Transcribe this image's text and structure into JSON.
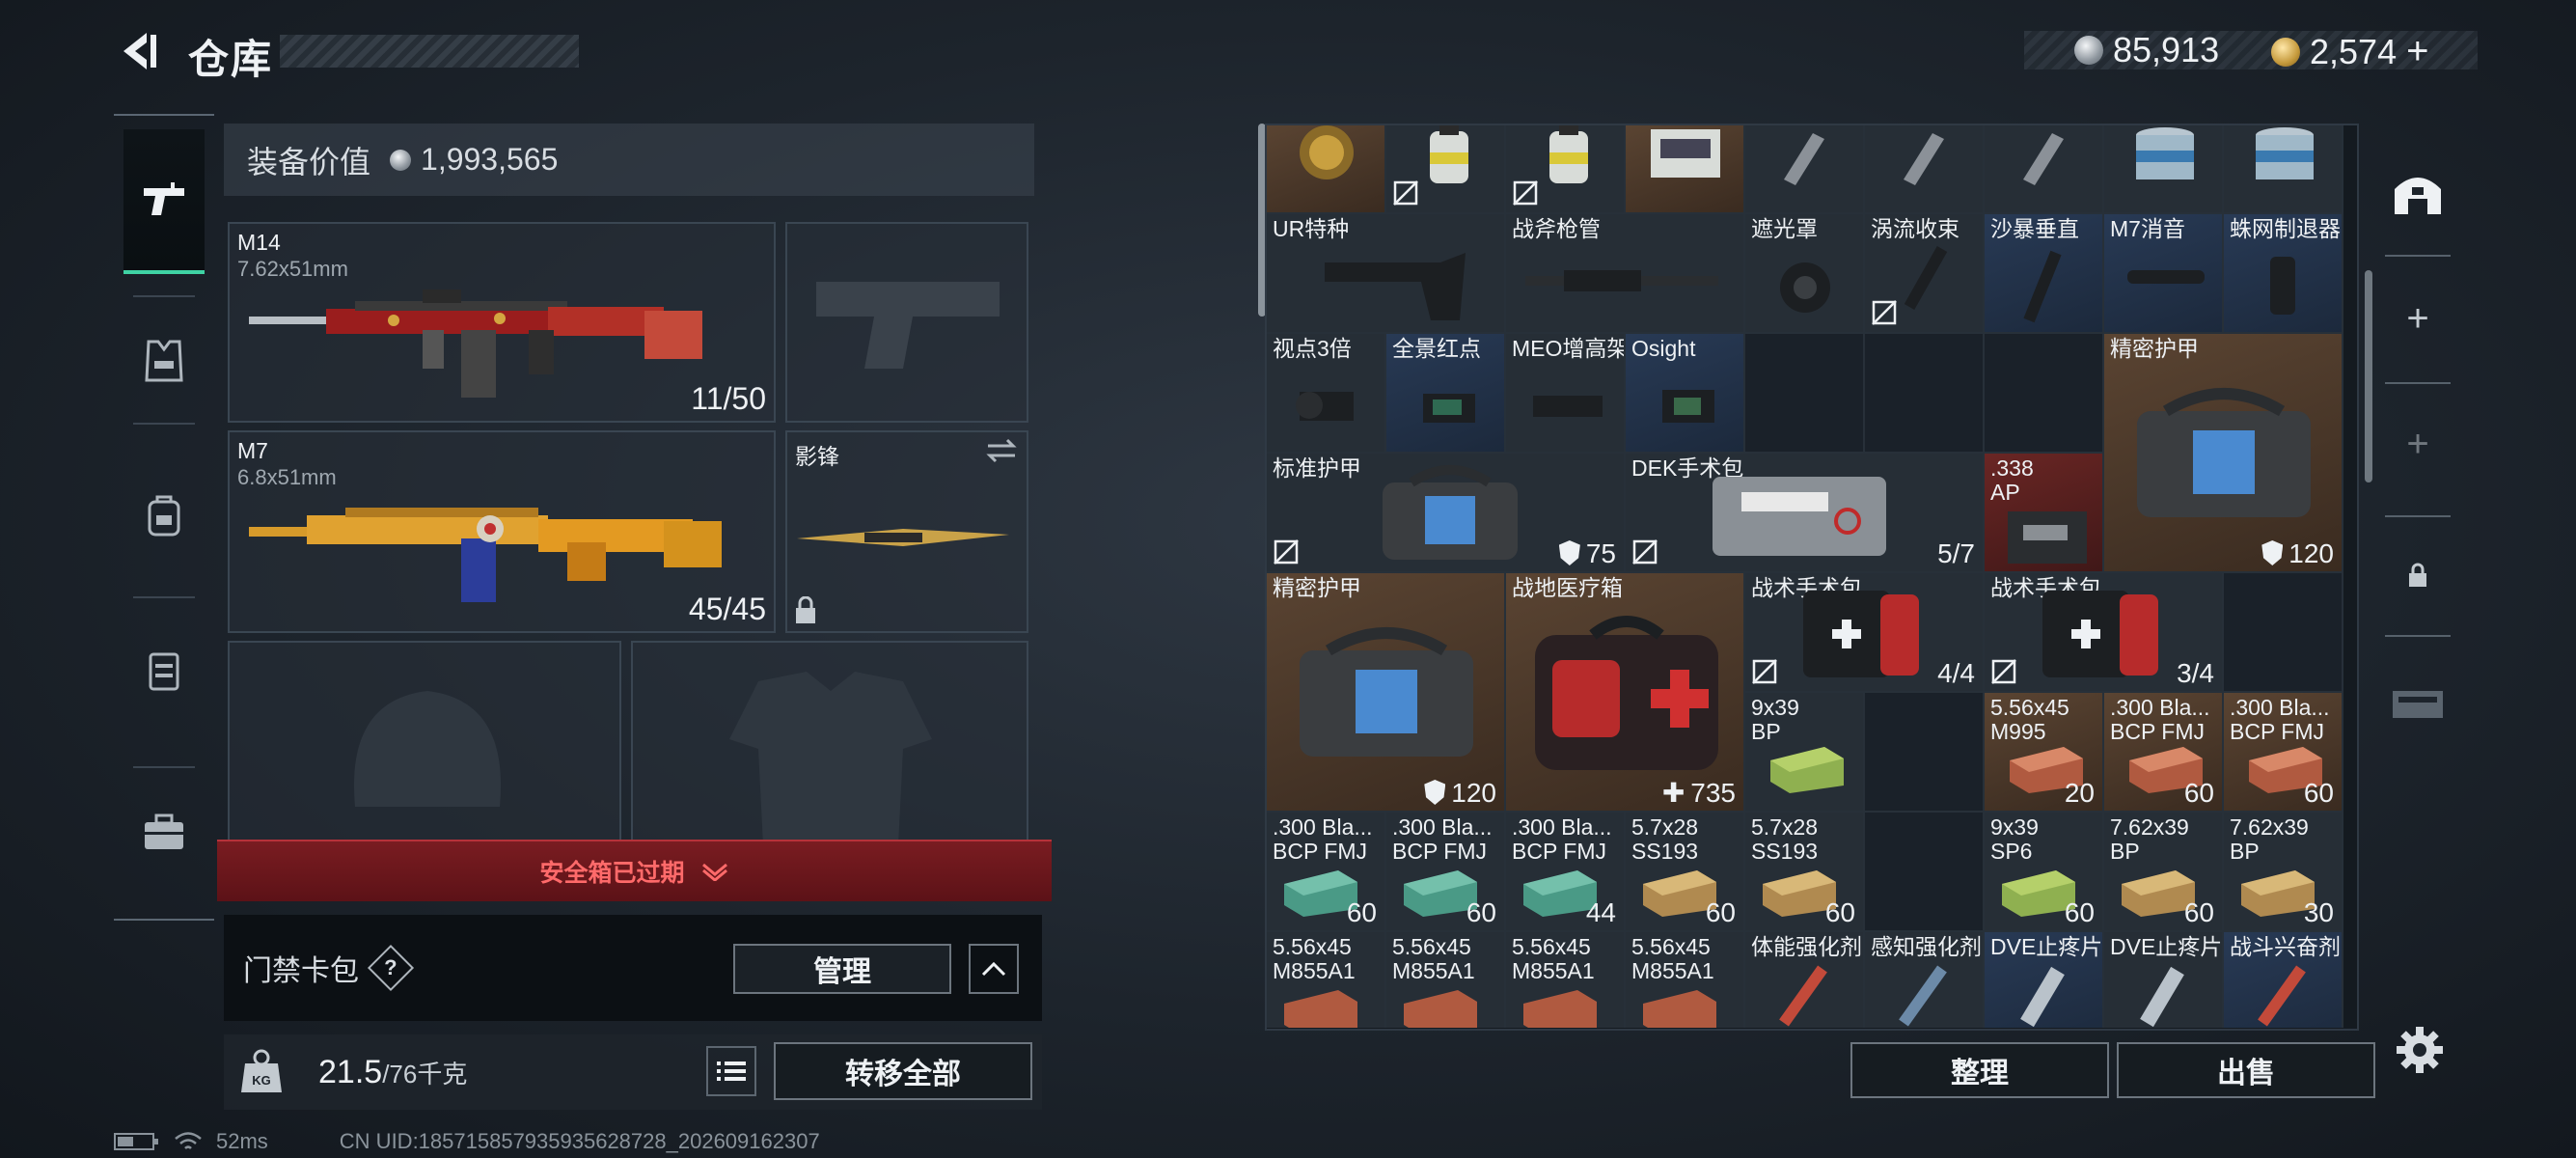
{
  "header": {
    "title": "仓库",
    "silver": "85,913",
    "gold": "2,574",
    "gold_plus": "+"
  },
  "rail": {
    "items": [
      "weapons-icon",
      "vest-icon",
      "backpack-icon",
      "rig-icon",
      "case-icon"
    ]
  },
  "loadout": {
    "equip_label": "装备价值",
    "equip_value": "1,993,565",
    "primary": {
      "name": "M14",
      "caliber": "7.62x51mm",
      "ammo": "11/50"
    },
    "secondary": {
      "name": "M7",
      "caliber": "6.8x51mm",
      "ammo": "45/45"
    },
    "melee": {
      "name": "影锋"
    },
    "safe_box": "安全箱已过期",
    "card_pack": "门禁卡包",
    "card_help": "?",
    "manage": "管理",
    "weight": "21.5",
    "weight_max": "/76千克",
    "transfer_all": "转移全部"
  },
  "status": {
    "ping": "52ms",
    "uid": "CN UID:18571585793593562872​8_202609162307"
  },
  "grid": {
    "row0": [
      {
        "nm": "",
        "cnt": ""
      },
      {
        "nm": "",
        "cnt": ""
      },
      {
        "nm": "",
        "cnt": ""
      },
      {
        "nm": "",
        "cnt": ""
      },
      {
        "nm": "",
        "cnt": ""
      },
      {
        "nm": "",
        "cnt": ""
      },
      {
        "nm": "",
        "cnt": ""
      },
      {
        "nm": "",
        "cnt": ""
      },
      {
        "nm": "",
        "cnt": ""
      }
    ],
    "r1": [
      "UR特种",
      "战斧枪管",
      "遮光罩",
      "涡流收束",
      "沙暴垂直",
      "M7消音",
      "蛛网制退器"
    ],
    "r2": [
      "视点3倍",
      "全景红点",
      "MEO增高架",
      "Osight"
    ],
    "armor1": {
      "nm": "精密护甲",
      "cnt": "120"
    },
    "armor_std": {
      "nm": "标准护甲",
      "cnt": "75"
    },
    "dek": {
      "nm": "DEK手术包",
      "cnt": "5/7"
    },
    "ap338": {
      "nm": ".338 AP"
    },
    "armor2": {
      "nm": "精密护甲",
      "cnt": "120"
    },
    "medbox": {
      "nm": "战地医疗箱",
      "cnt": "735"
    },
    "kit1": {
      "nm": "战术手术包",
      "cnt": "4/4"
    },
    "kit2": {
      "nm": "战术手术包",
      "cnt": "3/4"
    },
    "r6": [
      {
        "nm": "9x39 BP",
        "cnt": ""
      },
      {
        "nm": "5.56x45 M995",
        "cnt": "20"
      },
      {
        "nm": ".300 Bla... BCP FMJ",
        "cnt": "60"
      },
      {
        "nm": ".300 Bla... BCP FMJ",
        "cnt": "60"
      }
    ],
    "r7": [
      {
        "nm": ".300 Bla... BCP FMJ",
        "cnt": "60"
      },
      {
        "nm": ".300 Bla... BCP FMJ",
        "cnt": "60"
      },
      {
        "nm": ".300 Bla... BCP FMJ",
        "cnt": "44"
      },
      {
        "nm": "5.7x28 SS193",
        "cnt": "60"
      },
      {
        "nm": "5.7x28 SS193",
        "cnt": "60"
      },
      {
        "nm": "",
        "cnt": ""
      },
      {
        "nm": "9x39 SP6",
        "cnt": "60"
      },
      {
        "nm": "7.62x39 BP",
        "cnt": "60"
      },
      {
        "nm": "7.62x39 BP",
        "cnt": "30"
      }
    ],
    "r8": [
      {
        "nm": "5.56x45 M855A1"
      },
      {
        "nm": "5.56x45 M855A1"
      },
      {
        "nm": "5.56x45 M855A1"
      },
      {
        "nm": "5.56x45 M855A1"
      },
      {
        "nm": "体能强化剂"
      },
      {
        "nm": "感知强化剂"
      },
      {
        "nm": "DVE止疼片"
      },
      {
        "nm": "DVE止疼片"
      },
      {
        "nm": "战斗兴奋剂"
      }
    ],
    "tidy": "整理",
    "sell": "出售"
  },
  "colors": {
    "accent": "#3fd3a4",
    "danger": "#b5323a"
  }
}
